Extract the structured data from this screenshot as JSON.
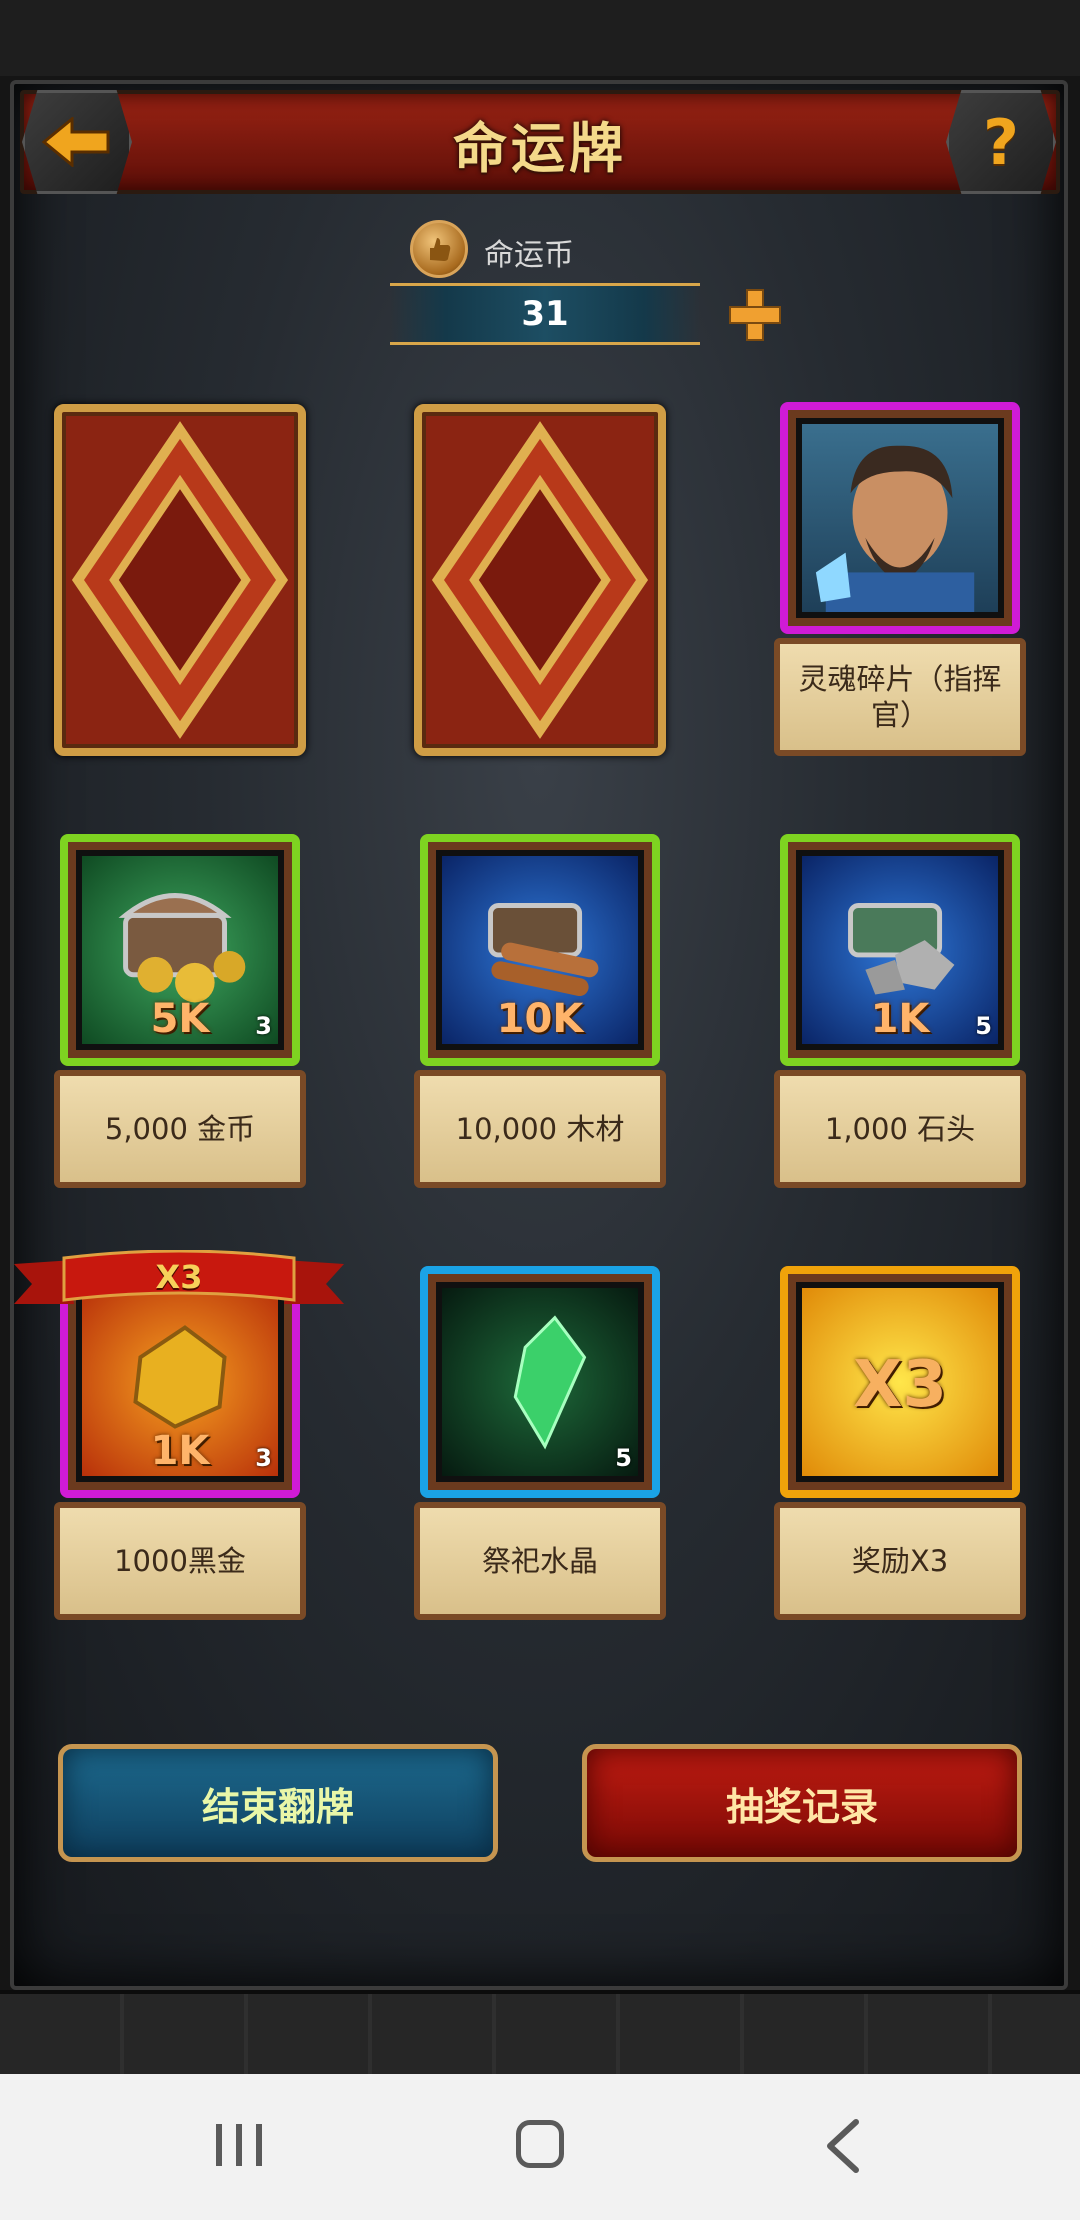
{
  "header": {
    "title": "命运牌"
  },
  "currency": {
    "label": "命运币",
    "amount": "31"
  },
  "rewards": [
    {
      "label": "灵魂碎片（指挥官）",
      "amount": "",
      "count": ""
    },
    {
      "label": "5,000 金币",
      "amount": "5K",
      "count": "3"
    },
    {
      "label": "10,000 木材",
      "amount": "10K",
      "count": ""
    },
    {
      "label": "1,000 石头",
      "amount": "1K",
      "count": "5"
    },
    {
      "label": "1000黑金",
      "amount": "1K",
      "count": "3",
      "ribbon": "X3"
    },
    {
      "label": "祭祀水晶",
      "amount": "",
      "count": "5"
    },
    {
      "label": "奖励X3",
      "amount": "X3",
      "count": ""
    }
  ],
  "buttons": {
    "end_flip": "结束翻牌",
    "draw_history": "抽奖记录"
  },
  "icons": {
    "back": "back-arrow-icon",
    "help": "question-mark-icon",
    "plus": "plus-icon",
    "coin": "fate-coin-icon"
  },
  "colors": {
    "header_red": "#8a1c10",
    "gold_border": "#cf9d45",
    "green_frame": "#7ed321",
    "purple_frame": "#d01bd6",
    "blue_frame": "#1aa3e6",
    "orange_frame": "#f0a30a",
    "blue_button": "#145476",
    "red_button": "#a5130b"
  }
}
